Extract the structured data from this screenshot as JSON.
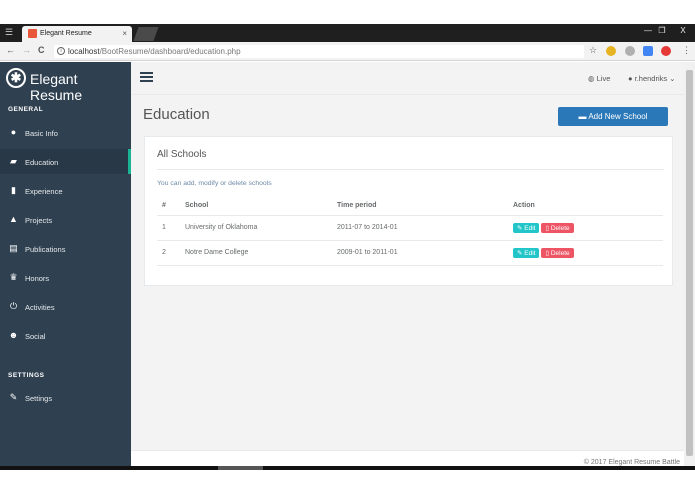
{
  "browser": {
    "tab_title": "Elegant Resume",
    "tab_close": "×",
    "menu_icon": "☰",
    "window_controls": [
      "—",
      "❐",
      "X"
    ],
    "back": "←",
    "forward": "→",
    "reload": "C",
    "url_host": "localhost",
    "url_path": "/BootResume/dashboard/education.php"
  },
  "sidebar": {
    "brand": "Elegant Resume",
    "general_title": "GENERAL",
    "settings_title": "SETTINGS",
    "items": [
      {
        "label": "Basic Info",
        "icon": "user-icon"
      },
      {
        "label": "Education",
        "icon": "book-icon"
      },
      {
        "label": "Experience",
        "icon": "briefcase-icon"
      },
      {
        "label": "Projects",
        "icon": "flask-icon"
      },
      {
        "label": "Publications",
        "icon": "file-icon"
      },
      {
        "label": "Honors",
        "icon": "trophy-icon"
      },
      {
        "label": "Activities",
        "icon": "power-icon"
      },
      {
        "label": "Social",
        "icon": "users-icon"
      }
    ],
    "settings_item": {
      "label": "Settings",
      "icon": "wrench-icon"
    }
  },
  "topnav": {
    "live": "Live",
    "user": "r.hendriks"
  },
  "page": {
    "title": "Education",
    "add_button": "Add New School"
  },
  "card": {
    "title": "All Schools",
    "description": "You can add, modify or delete schools",
    "headers": [
      "#",
      "School",
      "Time period",
      "Action"
    ],
    "rows": [
      {
        "num": "1",
        "school": "University of Oklahoma",
        "period": "2011-07 to 2014-01"
      },
      {
        "num": "2",
        "school": "Notre Dame College",
        "period": "2009-01 to 2011-01"
      }
    ],
    "edit_label": "Edit",
    "delete_label": "Delete"
  },
  "footer": {
    "text": "© 2017 Elegant Resume Battle"
  },
  "colors": {
    "sidebar": "#2f4050",
    "accent": "#1ab394",
    "primary_button": "#2b78b8",
    "edit_button": "#23c6c8",
    "delete_button": "#ed5565"
  }
}
